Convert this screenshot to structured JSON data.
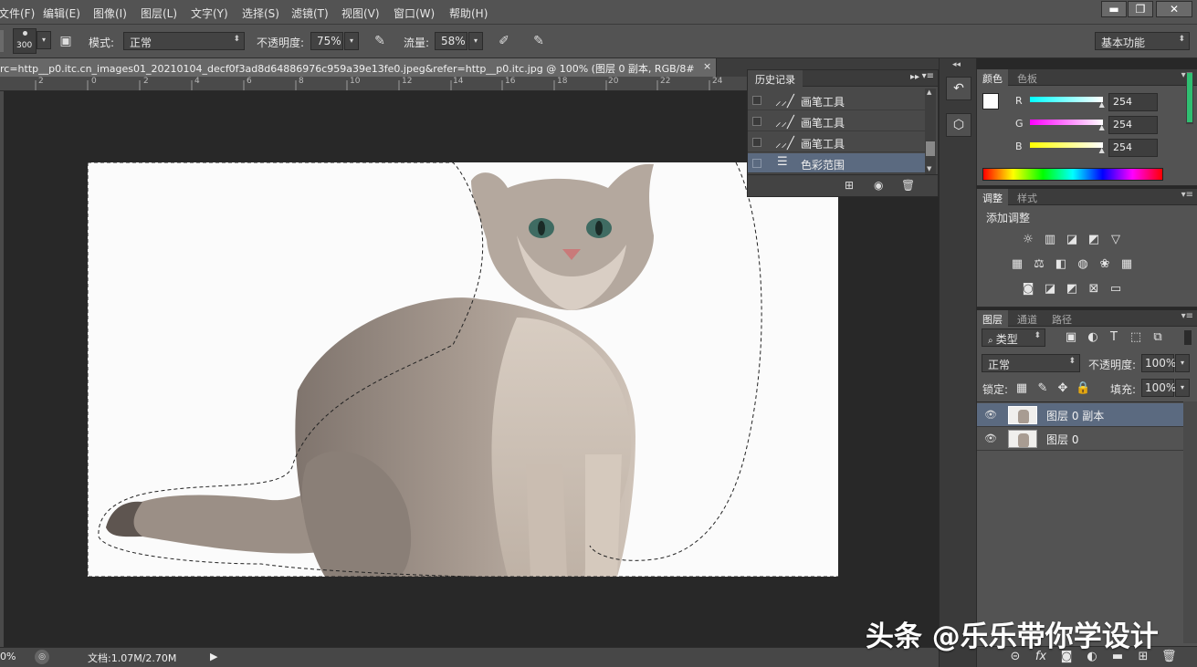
{
  "menu": [
    "文件(F)",
    "编辑(E)",
    "图像(I)",
    "图层(L)",
    "文字(Y)",
    "选择(S)",
    "滤镜(T)",
    "视图(V)",
    "窗口(W)",
    "帮助(H)"
  ],
  "window_controls": {
    "minimize": "▬",
    "restore": "❐",
    "close": "✕"
  },
  "options": {
    "brush_size": "300",
    "mode_label": "模式:",
    "mode_value": "正常",
    "opacity_label": "不透明度:",
    "opacity_value": "75%",
    "flow_label": "流量:",
    "flow_value": "58%",
    "workspace": "基本功能"
  },
  "document": {
    "tab_title": "rc=http__p0.itc.cn_images01_20210104_decf0f3ad8d64886976c959a39e13fe0.jpeg&refer=http__p0.itc.jpg @ 100% (图层 0 副本, RGB/8#) *",
    "close": "×"
  },
  "ruler_ticks": [
    "2",
    "0",
    "2",
    "4",
    "6",
    "8",
    "10",
    "12",
    "14",
    "16",
    "18",
    "20",
    "22",
    "24"
  ],
  "status": {
    "zoom": "0%",
    "doc_info": "文档:1.07M/2.70M"
  },
  "history": {
    "title": "历史记录",
    "items": [
      {
        "label": "画笔工具",
        "icon": "brush-icon"
      },
      {
        "label": "画笔工具",
        "icon": "brush-icon"
      },
      {
        "label": "画笔工具",
        "icon": "brush-icon"
      },
      {
        "label": "色彩范围",
        "icon": "document-icon"
      }
    ]
  },
  "color_panel": {
    "tabs": [
      "颜色",
      "色板"
    ],
    "r_label": "R",
    "g_label": "G",
    "b_label": "B",
    "r": "254",
    "g": "254",
    "b": "254",
    "r_level": 0.996,
    "g_level": 0.996,
    "b_level": 0.996,
    "colors": {
      "red_channel": "#00ffff",
      "green_channel": "#ff00ff",
      "blue_channel": "#ffff00"
    }
  },
  "adjust_panel": {
    "tabs": [
      "调整",
      "样式"
    ],
    "add_label": "添加调整"
  },
  "layers_panel": {
    "tabs": [
      "图层",
      "通道",
      "路径"
    ],
    "filter": "类型",
    "blend": "正常",
    "opacity_label": "不透明度:",
    "opacity": "100%",
    "lock_label": "锁定:",
    "fill_label": "填充:",
    "fill": "100%",
    "layers": [
      {
        "name": "图层 0 副本",
        "selected": true
      },
      {
        "name": "图层 0",
        "selected": false
      }
    ]
  },
  "watermark": "头条 @乐乐带你学设计"
}
